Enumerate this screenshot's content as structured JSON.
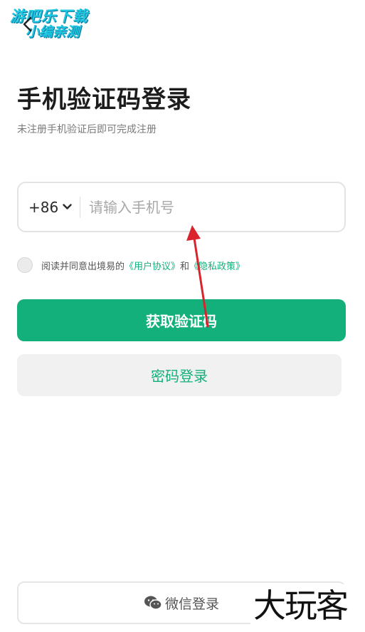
{
  "watermark": {
    "line1": "游吧乐下载",
    "line2": "小编亲测"
  },
  "header": {
    "title": "手机验证码登录",
    "subtitle": "未注册手机验证后即可完成注册"
  },
  "phone": {
    "country_code": "+86",
    "placeholder": "请输入手机号",
    "value": ""
  },
  "agreement": {
    "prefix": "阅读并同意出境易的",
    "user_agreement": "《用户协议》",
    "connector": "和",
    "privacy_policy": "《隐私政策》",
    "checked": false
  },
  "actions": {
    "get_code": "获取验证码",
    "password_login": "密码登录",
    "wechat_login": "微信登录"
  },
  "corner_logo": "大玩客",
  "colors": {
    "accent": "#13b07b",
    "annotation_arrow": "#d9232d"
  },
  "icons": [
    "back-arrow-icon",
    "chevron-down-icon",
    "wechat-icon"
  ]
}
